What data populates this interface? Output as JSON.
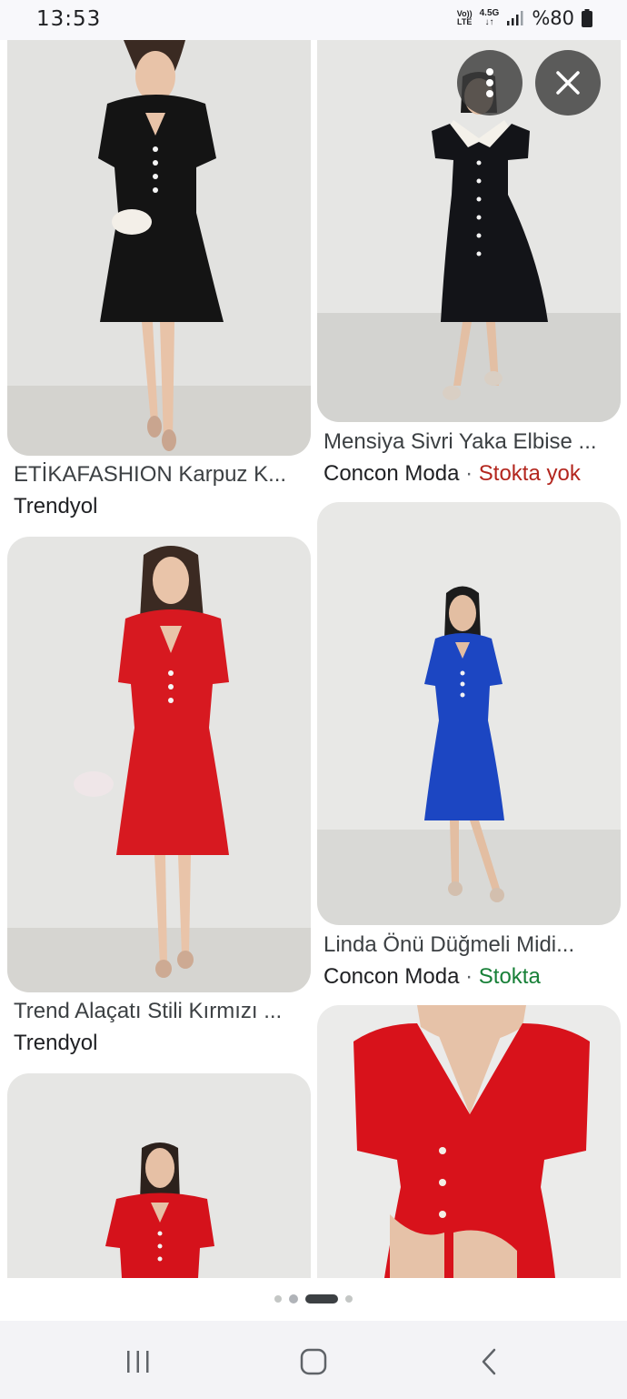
{
  "status_bar": {
    "time": "13:53",
    "volte_top": "Vo))",
    "volte_bottom": "LTE",
    "network_top": "4.5G",
    "network_bottom": "↓↑",
    "battery": "%80"
  },
  "results": [
    {
      "id": "black-dress-white-bag",
      "title": "ETİKAFASHION Karpuz K...",
      "source": "Trendyol",
      "stock": "",
      "stock_status": ""
    },
    {
      "id": "black-dress-white-collar",
      "title": "Mensiya Sivri Yaka Elbise ...",
      "source": "Concon Moda",
      "separator": "·",
      "stock": "Stokta yok",
      "stock_status": "out"
    },
    {
      "id": "red-dress-bag",
      "title": "Trend Alaçatı Stili Kırmızı ...",
      "source": "Trendyol",
      "stock": "",
      "stock_status": ""
    },
    {
      "id": "blue-dress",
      "title": "Linda Önü Düğmeli Midi...",
      "source": "Concon Moda",
      "separator": "·",
      "stock": "Stokta",
      "stock_status": "in"
    },
    {
      "id": "red-dress-partial",
      "title": "",
      "source": "",
      "stock": ""
    },
    {
      "id": "red-dress-closeup",
      "title": "",
      "source": "",
      "stock": ""
    }
  ],
  "overlay": {
    "more_icon": "more-vert-icon",
    "close_icon": "close-icon"
  },
  "pager": {
    "count": 5,
    "active_index": 2
  },
  "nav": {
    "recents_icon": "recents-icon",
    "home_icon": "home-icon",
    "back_icon": "back-icon"
  },
  "colors": {
    "out_of_stock": "#b3261e",
    "in_stock": "#188038",
    "overlay_button": "#3c3c3c"
  }
}
